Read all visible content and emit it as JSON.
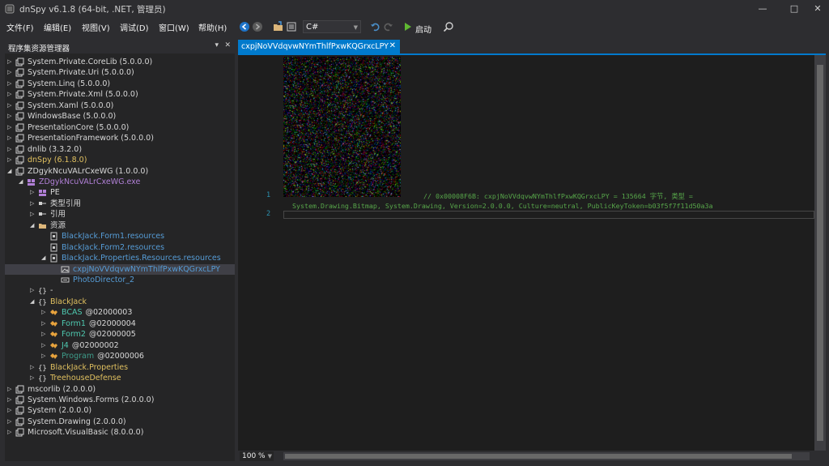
{
  "window": {
    "title": "dnSpy v6.1.8 (64-bit, .NET, 管理员)",
    "minimize": "—",
    "maximize": "□",
    "close": "✕"
  },
  "menu": [
    "文件(F)",
    "编辑(E)",
    "视图(V)",
    "调试(D)",
    "窗口(W)",
    "帮助(H)"
  ],
  "toolbar": {
    "language": "C#",
    "run_label": "启动",
    "icons": [
      "back-icon",
      "forward-icon",
      "open-file-icon",
      "open-list-icon",
      "undo-icon",
      "redo-icon",
      "run-icon",
      "search-icon"
    ]
  },
  "explorer": {
    "title": "程序集资源管理器",
    "pin": "▾",
    "close": "✕",
    "items": [
      {
        "label": "System.Private.CoreLib (5.0.0.0)",
        "icon": "assembly",
        "color": "#d8d8d8"
      },
      {
        "label": "System.Private.Uri (5.0.0.0)",
        "icon": "assembly",
        "color": "#d8d8d8"
      },
      {
        "label": "System.Linq (5.0.0.0)",
        "icon": "assembly",
        "color": "#d8d8d8"
      },
      {
        "label": "System.Private.Xml (5.0.0.0)",
        "icon": "assembly",
        "color": "#d8d8d8"
      },
      {
        "label": "System.Xaml (5.0.0.0)",
        "icon": "assembly",
        "color": "#d8d8d8"
      },
      {
        "label": "WindowsBase (5.0.0.0)",
        "icon": "assembly",
        "color": "#d8d8d8"
      },
      {
        "label": "PresentationCore (5.0.0.0)",
        "icon": "assembly",
        "color": "#d8d8d8"
      },
      {
        "label": "PresentationFramework (5.0.0.0)",
        "icon": "assembly",
        "color": "#d8d8d8"
      },
      {
        "label": "dnlib (3.3.2.0)",
        "icon": "assembly",
        "color": "#d8d8d8"
      },
      {
        "label": "dnSpy (6.1.8.0)",
        "icon": "assembly",
        "color": "#e0c060"
      },
      {
        "label": "ZDgykNcuVALrCxeWG (1.0.0.0)",
        "icon": "assembly",
        "color": "#d8d8d8"
      },
      {
        "label": "ZDgykNcuVALrCxeWG.exe",
        "icon": "module",
        "color": "#b180d7"
      },
      {
        "label": "PE",
        "icon": "pe",
        "color": "#d8d8d8"
      },
      {
        "label": "类型引用",
        "icon": "typeref",
        "color": "#d8d8d8"
      },
      {
        "label": "引用",
        "icon": "ref",
        "color": "#d8d8d8"
      },
      {
        "label": "资源",
        "icon": "folder",
        "color": "#d8d8d8"
      },
      {
        "label": "BlackJack.Form1.resources",
        "icon": "resource",
        "color": "#569cd6"
      },
      {
        "label": "BlackJack.Form2.resources",
        "icon": "resource",
        "color": "#569cd6"
      },
      {
        "label": "BlackJack.Properties.Resources.resources",
        "icon": "resource",
        "color": "#569cd6"
      },
      {
        "label": "cxpjNoVVdqvwNYmThlfPxwKQGrxcLPY",
        "icon": "image",
        "color": "#569cd6"
      },
      {
        "label": "PhotoDirector_2",
        "icon": "binary",
        "color": "#569cd6"
      },
      {
        "label": "-",
        "icon": "namespace",
        "color": "#d8d8d8"
      },
      {
        "label": "BlackJack",
        "icon": "namespace",
        "color": "#e0c060"
      },
      {
        "label": "BCAS",
        "token": "@02000003",
        "icon": "class",
        "color": "#4ec9b0"
      },
      {
        "label": "Form1",
        "token": "@02000004",
        "icon": "class",
        "color": "#4ec9b0"
      },
      {
        "label": "Form2",
        "token": "@02000005",
        "icon": "class",
        "color": "#4ec9b0"
      },
      {
        "label": "J4",
        "token": "@02000002",
        "icon": "class",
        "color": "#4ec9b0"
      },
      {
        "label": "Program",
        "token": "@02000006",
        "icon": "class",
        "color": "#3e9d8a"
      },
      {
        "label": "BlackJack.Properties",
        "icon": "namespace",
        "color": "#e0c060"
      },
      {
        "label": "TreehouseDefense",
        "icon": "namespace",
        "color": "#e0c060"
      },
      {
        "label": "mscorlib (2.0.0.0)",
        "icon": "assembly",
        "color": "#d8d8d8"
      },
      {
        "label": "System.Windows.Forms (2.0.0.0)",
        "icon": "assembly",
        "color": "#d8d8d8"
      },
      {
        "label": "System (2.0.0.0)",
        "icon": "assembly",
        "color": "#d8d8d8"
      },
      {
        "label": "System.Drawing (2.0.0.0)",
        "icon": "assembly",
        "color": "#d8d8d8"
      },
      {
        "label": "Microsoft.VisualBasic (8.0.0.0)",
        "icon": "assembly",
        "color": "#d8d8d8"
      }
    ]
  },
  "tab": {
    "title": "cxpjNoVVdqvwNYmThlfPxwKQGrxcLPY",
    "close": "✕"
  },
  "editor": {
    "line1_num": "1",
    "line2_num": "2",
    "comment_line1": "// 0x00008F6B: cxpjNoVVdqvwNYmThlfPxwKQGrxcLPY = 135664 字节, 类型 =",
    "comment_line2": "System.Drawing.Bitmap, System.Drawing, Version=2.0.0.0, Culture=neutral, PublicKeyToken=b03f5f7f11d50a3a"
  },
  "status": {
    "zoom": "100 %"
  }
}
